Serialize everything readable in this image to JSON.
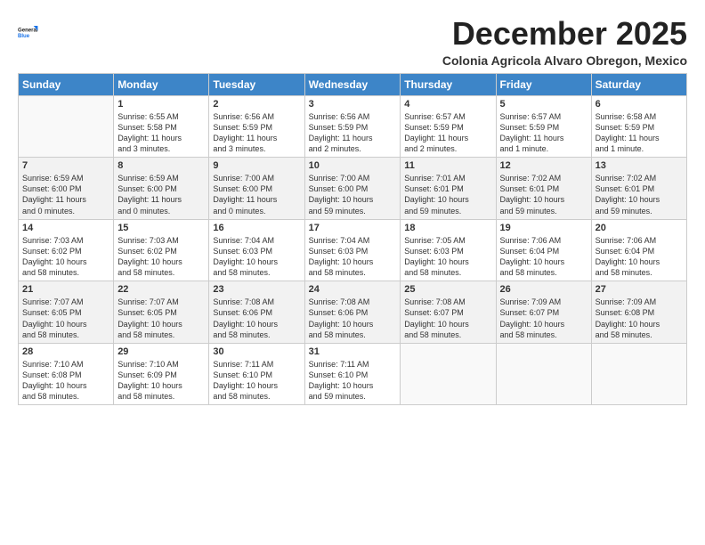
{
  "header": {
    "logo_line1": "General",
    "logo_line2": "Blue",
    "month": "December 2025",
    "location": "Colonia Agricola Alvaro Obregon, Mexico"
  },
  "columns": [
    "Sunday",
    "Monday",
    "Tuesday",
    "Wednesday",
    "Thursday",
    "Friday",
    "Saturday"
  ],
  "weeks": [
    [
      {
        "day": "",
        "info": ""
      },
      {
        "day": "1",
        "info": "Sunrise: 6:55 AM\nSunset: 5:58 PM\nDaylight: 11 hours\nand 3 minutes."
      },
      {
        "day": "2",
        "info": "Sunrise: 6:56 AM\nSunset: 5:59 PM\nDaylight: 11 hours\nand 3 minutes."
      },
      {
        "day": "3",
        "info": "Sunrise: 6:56 AM\nSunset: 5:59 PM\nDaylight: 11 hours\nand 2 minutes."
      },
      {
        "day": "4",
        "info": "Sunrise: 6:57 AM\nSunset: 5:59 PM\nDaylight: 11 hours\nand 2 minutes."
      },
      {
        "day": "5",
        "info": "Sunrise: 6:57 AM\nSunset: 5:59 PM\nDaylight: 11 hours\nand 1 minute."
      },
      {
        "day": "6",
        "info": "Sunrise: 6:58 AM\nSunset: 5:59 PM\nDaylight: 11 hours\nand 1 minute."
      }
    ],
    [
      {
        "day": "7",
        "info": "Sunrise: 6:59 AM\nSunset: 6:00 PM\nDaylight: 11 hours\nand 0 minutes."
      },
      {
        "day": "8",
        "info": "Sunrise: 6:59 AM\nSunset: 6:00 PM\nDaylight: 11 hours\nand 0 minutes."
      },
      {
        "day": "9",
        "info": "Sunrise: 7:00 AM\nSunset: 6:00 PM\nDaylight: 11 hours\nand 0 minutes."
      },
      {
        "day": "10",
        "info": "Sunrise: 7:00 AM\nSunset: 6:00 PM\nDaylight: 10 hours\nand 59 minutes."
      },
      {
        "day": "11",
        "info": "Sunrise: 7:01 AM\nSunset: 6:01 PM\nDaylight: 10 hours\nand 59 minutes."
      },
      {
        "day": "12",
        "info": "Sunrise: 7:02 AM\nSunset: 6:01 PM\nDaylight: 10 hours\nand 59 minutes."
      },
      {
        "day": "13",
        "info": "Sunrise: 7:02 AM\nSunset: 6:01 PM\nDaylight: 10 hours\nand 59 minutes."
      }
    ],
    [
      {
        "day": "14",
        "info": "Sunrise: 7:03 AM\nSunset: 6:02 PM\nDaylight: 10 hours\nand 58 minutes."
      },
      {
        "day": "15",
        "info": "Sunrise: 7:03 AM\nSunset: 6:02 PM\nDaylight: 10 hours\nand 58 minutes."
      },
      {
        "day": "16",
        "info": "Sunrise: 7:04 AM\nSunset: 6:03 PM\nDaylight: 10 hours\nand 58 minutes."
      },
      {
        "day": "17",
        "info": "Sunrise: 7:04 AM\nSunset: 6:03 PM\nDaylight: 10 hours\nand 58 minutes."
      },
      {
        "day": "18",
        "info": "Sunrise: 7:05 AM\nSunset: 6:03 PM\nDaylight: 10 hours\nand 58 minutes."
      },
      {
        "day": "19",
        "info": "Sunrise: 7:06 AM\nSunset: 6:04 PM\nDaylight: 10 hours\nand 58 minutes."
      },
      {
        "day": "20",
        "info": "Sunrise: 7:06 AM\nSunset: 6:04 PM\nDaylight: 10 hours\nand 58 minutes."
      }
    ],
    [
      {
        "day": "21",
        "info": "Sunrise: 7:07 AM\nSunset: 6:05 PM\nDaylight: 10 hours\nand 58 minutes."
      },
      {
        "day": "22",
        "info": "Sunrise: 7:07 AM\nSunset: 6:05 PM\nDaylight: 10 hours\nand 58 minutes."
      },
      {
        "day": "23",
        "info": "Sunrise: 7:08 AM\nSunset: 6:06 PM\nDaylight: 10 hours\nand 58 minutes."
      },
      {
        "day": "24",
        "info": "Sunrise: 7:08 AM\nSunset: 6:06 PM\nDaylight: 10 hours\nand 58 minutes."
      },
      {
        "day": "25",
        "info": "Sunrise: 7:08 AM\nSunset: 6:07 PM\nDaylight: 10 hours\nand 58 minutes."
      },
      {
        "day": "26",
        "info": "Sunrise: 7:09 AM\nSunset: 6:07 PM\nDaylight: 10 hours\nand 58 minutes."
      },
      {
        "day": "27",
        "info": "Sunrise: 7:09 AM\nSunset: 6:08 PM\nDaylight: 10 hours\nand 58 minutes."
      }
    ],
    [
      {
        "day": "28",
        "info": "Sunrise: 7:10 AM\nSunset: 6:08 PM\nDaylight: 10 hours\nand 58 minutes."
      },
      {
        "day": "29",
        "info": "Sunrise: 7:10 AM\nSunset: 6:09 PM\nDaylight: 10 hours\nand 58 minutes."
      },
      {
        "day": "30",
        "info": "Sunrise: 7:11 AM\nSunset: 6:10 PM\nDaylight: 10 hours\nand 58 minutes."
      },
      {
        "day": "31",
        "info": "Sunrise: 7:11 AM\nSunset: 6:10 PM\nDaylight: 10 hours\nand 59 minutes."
      },
      {
        "day": "",
        "info": ""
      },
      {
        "day": "",
        "info": ""
      },
      {
        "day": "",
        "info": ""
      }
    ]
  ]
}
